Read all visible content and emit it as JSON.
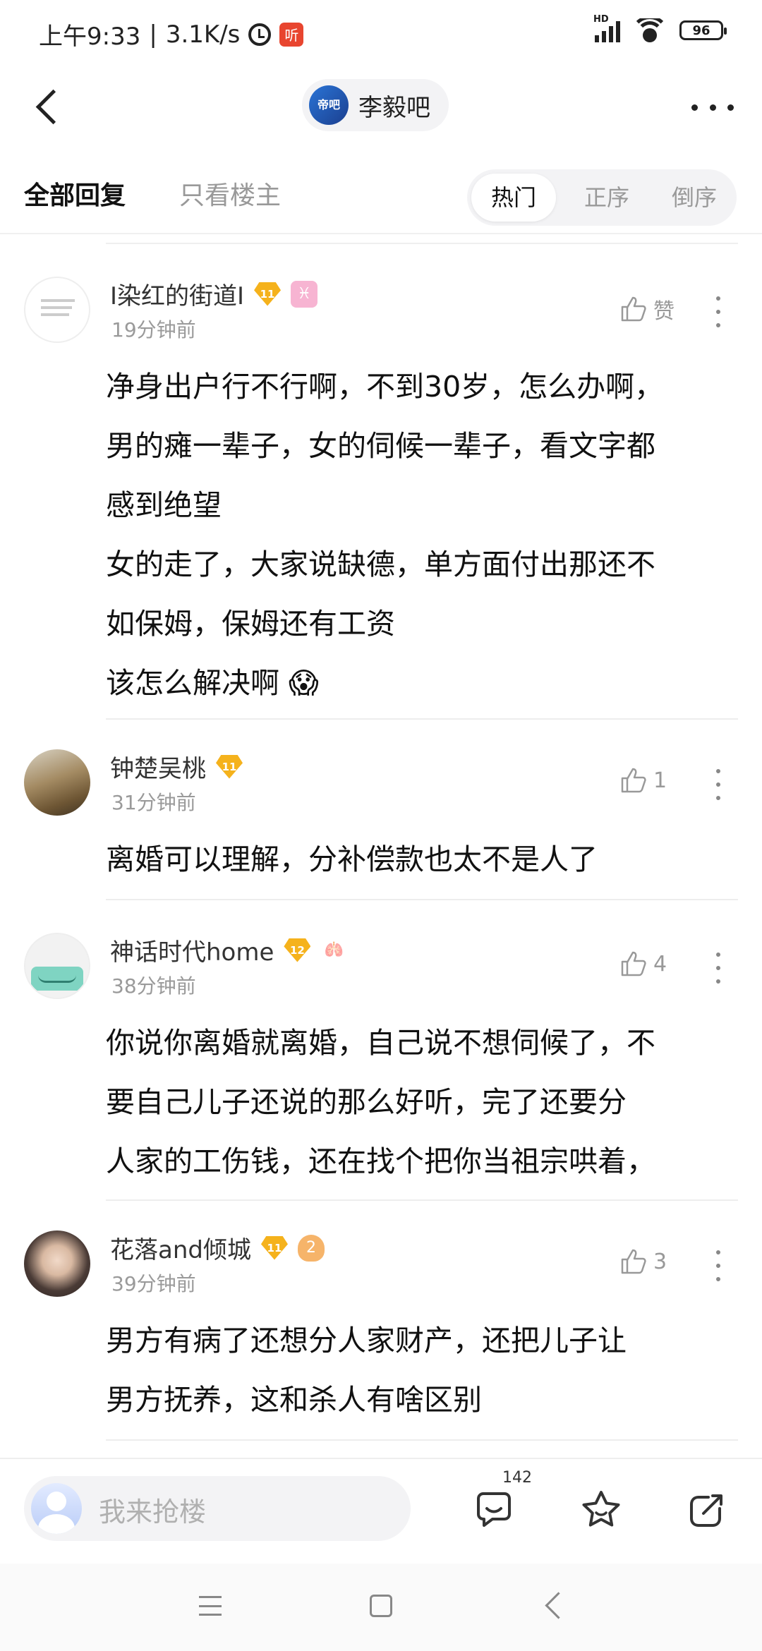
{
  "status": {
    "time": "上午9:33",
    "speed": "3.1K/s",
    "app_badge": "听",
    "network": "HD",
    "battery": "96"
  },
  "nav": {
    "forum_logo_text": "帝吧",
    "forum_name": "李毅吧"
  },
  "tabs": {
    "all_replies": "全部回复",
    "owner_only": "只看楼主",
    "sort": [
      "热门",
      "正序",
      "倒序"
    ]
  },
  "comments": [
    {
      "username": "I染红的街道I",
      "level": "11",
      "extra_badge": "♓",
      "time": "19分钟前",
      "like_label": "赞",
      "text": "净身出户行不行啊，不到30岁，怎么办啊，\n男的瘫一辈子，女的伺候一辈子，看文字都\n感到绝望\n女的走了，大家说缺德，单方面付出那还不\n如保姆，保姆还有工资\n该怎么解决啊 😱"
    },
    {
      "username": "钟楚吴桃",
      "level": "11",
      "time": "31分钟前",
      "like_label": "1",
      "text": "离婚可以理解，分补偿款也太不是人了"
    },
    {
      "username": "神话时代home",
      "level": "12",
      "extra_badge": "🫁",
      "time": "38分钟前",
      "like_label": "4",
      "text": "你说你离婚就离婚，自己说不想伺候了，不\n要自己儿子还说的那么好听，完了还要分\n人家的工伤钱，还在找个把你当祖宗哄着，"
    },
    {
      "username": "花落and倾城",
      "level": "11",
      "extra_badge": "2",
      "time": "39分钟前",
      "like_label": "3",
      "text": "男方有病了还想分人家财产，还把儿子让\n男方抚养，这和杀人有啥区别"
    }
  ],
  "bottom": {
    "placeholder": "我来抢楼",
    "comment_count": "142"
  },
  "colors": {
    "level_badge": "#f5b21c",
    "secondary_text": "#999999",
    "pill_bg": "#f3f3f5"
  }
}
